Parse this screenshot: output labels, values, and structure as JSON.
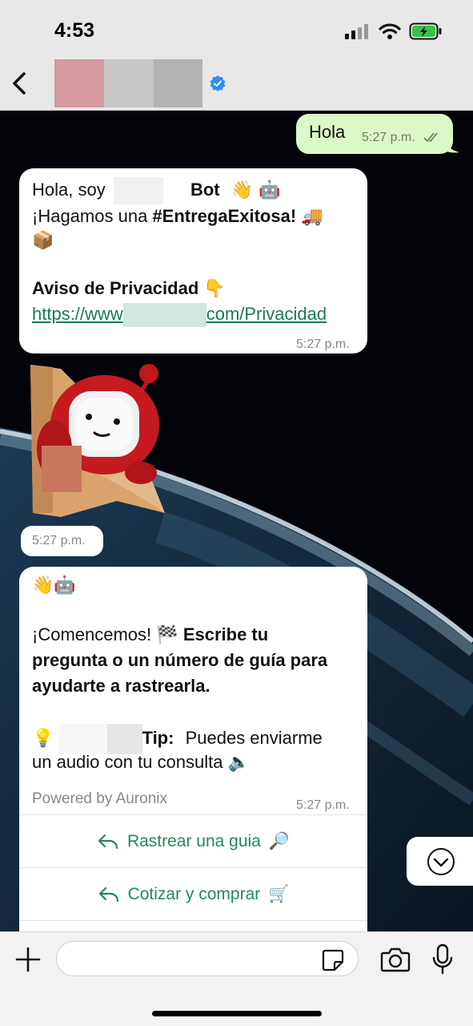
{
  "status": {
    "time": "4:53"
  },
  "outgoing": {
    "text": "Hola",
    "time": "5:27 p.m."
  },
  "greeting": {
    "hello": "Hola, soy",
    "bot": "Bot",
    "bot_emoji": "👋 🤖",
    "line2_prefix": "¡Hagamos una ",
    "hashtag": "#EntregaExitosa!",
    "line2_emoji": "🚚",
    "line3_emoji": "📦",
    "privacy_title": "Aviso de Privacidad",
    "privacy_emoji": "👇",
    "link_start": "https://www",
    "link_end": "com/Privacidad",
    "time": "5:27 p.m."
  },
  "sticker": {
    "time": "5:27 p.m."
  },
  "menu_message": {
    "top_emoji": "👋🤖",
    "start": "¡Comencemos!",
    "start_emoji": "🏁",
    "bold_1": "Escribe tu",
    "bold_2": "pregunta o un número de guía para",
    "bold_3": "ayudarte a rastrearla.",
    "tip_emoji": "💡",
    "tip_label": "Tip:",
    "tip_text": "Puedes enviarme",
    "tip_line2": "un audio con tu consulta",
    "tip_line2_emoji": "🔈",
    "footer": "Powered by Auronix",
    "time": "5:27 p.m.",
    "buttons": [
      {
        "label": "Rastrear una guia",
        "emoji": "🔎"
      },
      {
        "label": "Cotizar y comprar",
        "emoji": "🛒"
      }
    ]
  },
  "composer": {
    "placeholder": ""
  },
  "colors": {
    "outgoing_bubble": "#dcf8c6",
    "accent": "#1f8a5b",
    "verified": "#2f8cf2"
  }
}
